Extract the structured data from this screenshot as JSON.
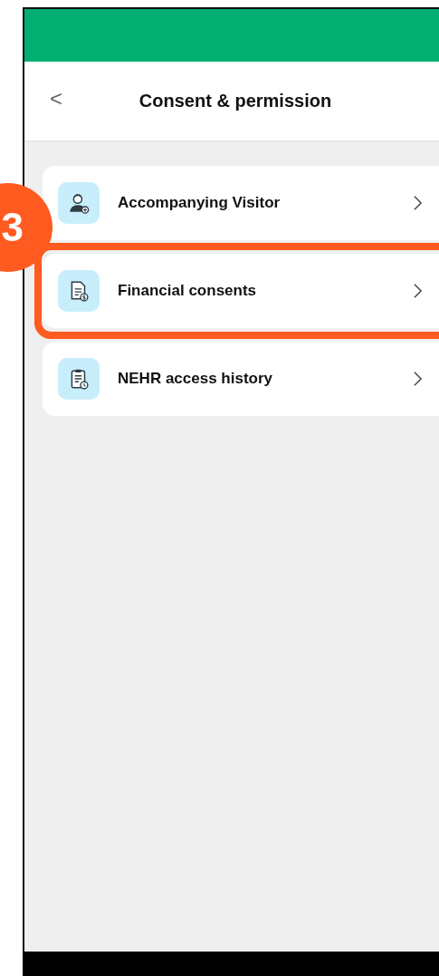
{
  "header": {
    "title": "Consent & permission",
    "back": "<"
  },
  "items": [
    {
      "label": "Accompanying Visitor",
      "highlighted": false
    },
    {
      "label": "Financial consents",
      "highlighted": true
    },
    {
      "label": "NEHR access history",
      "highlighted": false
    }
  ],
  "annotation": {
    "label": "3"
  }
}
